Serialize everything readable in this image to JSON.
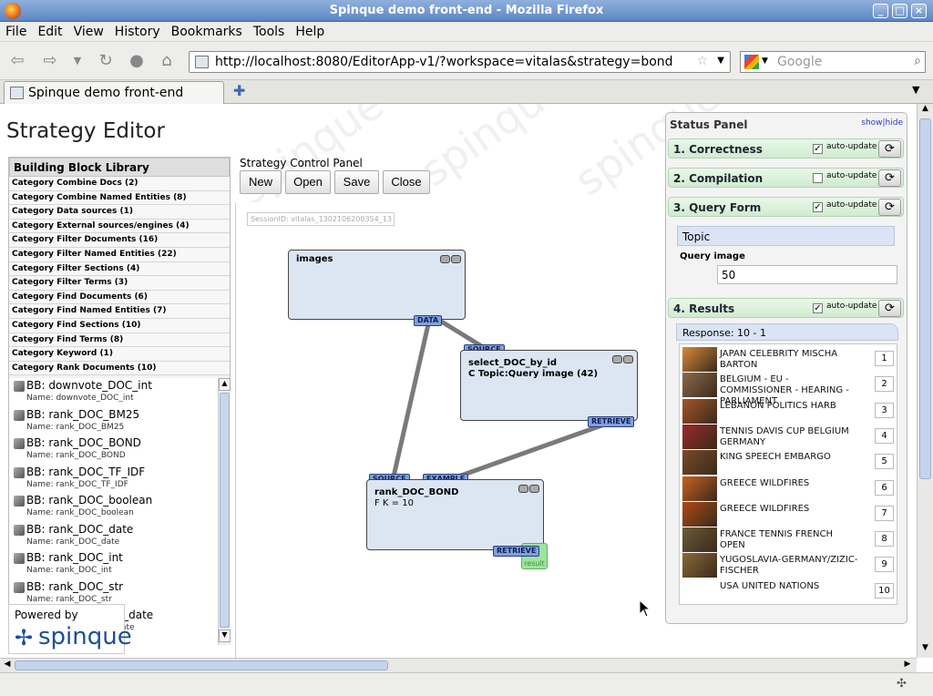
{
  "window": {
    "title": "Spinque demo front-end - Mozilla Firefox"
  },
  "menu": [
    "File",
    "Edit",
    "View",
    "History",
    "Bookmarks",
    "Tools",
    "Help"
  ],
  "nav": {
    "url": "http://localhost:8080/EditorApp-v1/?workspace=vitalas&strategy=bond",
    "search_placeholder": "Google"
  },
  "tab": {
    "label": "Spinque demo front-end"
  },
  "page": {
    "title": "Strategy Editor",
    "watermark": "spinque"
  },
  "library": {
    "header": "Building Block Library",
    "categories": [
      "Category Combine Docs (2)",
      "Category Combine Named Entities (8)",
      "Category Data sources (1)",
      "Category External sources/engines (4)",
      "Category Filter Documents (16)",
      "Category Filter Named Entities (22)",
      "Category Filter Sections (4)",
      "Category Filter Terms (3)",
      "Category Find Documents (6)",
      "Category Find Named Entities (7)",
      "Category Find Sections (10)",
      "Category Find Terms (8)",
      "Category Keyword (1)",
      "Category Rank Documents (10)"
    ],
    "blocks": [
      {
        "title": "BB: downvote_DOC_int",
        "name": "Name: downvote_DOC_int"
      },
      {
        "title": "BB: rank_DOC_BM25",
        "name": "Name: rank_DOC_BM25"
      },
      {
        "title": "BB: rank_DOC_BOND",
        "name": "Name: rank_DOC_BOND"
      },
      {
        "title": "BB: rank_DOC_TF_IDF",
        "name": "Name: rank_DOC_TF_IDF"
      },
      {
        "title": "BB: rank_DOC_boolean",
        "name": "Name: rank_DOC_boolean"
      },
      {
        "title": "BB: rank_DOC_date",
        "name": "Name: rank_DOC_date"
      },
      {
        "title": "BB: rank_DOC_int",
        "name": "Name: rank_DOC_int"
      },
      {
        "title": "BB: rank_DOC_str",
        "name": "Name: rank_DOC_str"
      },
      {
        "title": "BB: rank_DOC_str_date",
        "name": "Name: rank_DOC_str_date"
      }
    ],
    "powered_by": "Powered by",
    "brand": "spinque"
  },
  "control": {
    "label": "Strategy Control Panel",
    "new": "New",
    "open": "Open",
    "save": "Save",
    "close": "Close"
  },
  "session": "SessionID: vitalas_1302106200354_13",
  "graph": {
    "images": {
      "title": "images",
      "port_data": "DATA"
    },
    "select": {
      "port_source": "SOURCE",
      "title": "select_DOC_by_id",
      "sub": "C Topic:Query image (42)",
      "port_retrieve": "RETRIEVE"
    },
    "rank": {
      "port_source": "SOURCE",
      "port_example": "EXAMPLE",
      "title": "rank_DOC_BOND",
      "sub": "F K = 10",
      "port_retrieve": "RETRIEVE",
      "result": "result"
    }
  },
  "status": {
    "title": "Status Panel",
    "showhide": "show|hide",
    "sections": [
      {
        "label": "1. Correctness",
        "checked": true,
        "auto": "auto-update"
      },
      {
        "label": "2. Compilation",
        "checked": false,
        "auto": "auto-update"
      },
      {
        "label": "3. Query Form",
        "checked": true,
        "auto": "auto-update"
      },
      {
        "label": "4. Results",
        "checked": true,
        "auto": "auto-update"
      }
    ],
    "query": {
      "topic": "Topic",
      "image_label": "Query image",
      "image_value": "50"
    },
    "response": "Response: 10 - 1",
    "results": [
      {
        "label": "JAPAN CELEBRITY MISCHA BARTON",
        "rank": "1",
        "color": "#d88a3a"
      },
      {
        "label": "BELGIUM - EU - COMMISSIONER - HEARING - PARLIAMENT",
        "rank": "2",
        "color": "#8c6a4e"
      },
      {
        "label": "LEBANON POLITICS HARB",
        "rank": "3",
        "color": "#a3562a"
      },
      {
        "label": "TENNIS DAVIS CUP BELGIUM GERMANY",
        "rank": "4",
        "color": "#9a2a2a"
      },
      {
        "label": "KING SPEECH EMBARGO",
        "rank": "5",
        "color": "#7a4a2a"
      },
      {
        "label": "GREECE WILDFIRES",
        "rank": "6",
        "color": "#c8621e"
      },
      {
        "label": "GREECE WILDFIRES",
        "rank": "7",
        "color": "#b04a14"
      },
      {
        "label": "FRANCE TENNIS FRENCH OPEN",
        "rank": "8",
        "color": "#6a5a3a"
      },
      {
        "label": "YUGOSLAVIA-GERMANY/ZIZIC-FISCHER",
        "rank": "9",
        "color": "#8a6a3a"
      },
      {
        "label": "USA UNITED NATIONS",
        "rank": "10",
        "color": ""
      }
    ]
  }
}
